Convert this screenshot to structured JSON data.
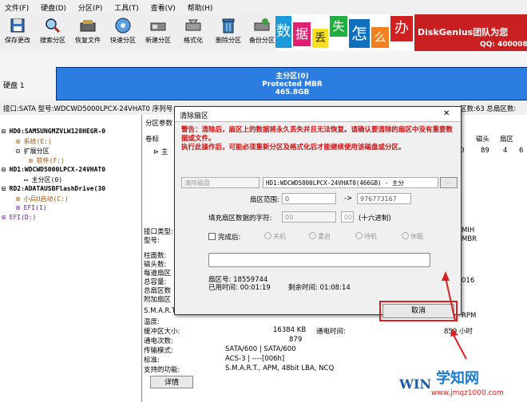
{
  "menu": [
    "文件(F)",
    "硬盘(D)",
    "分区(P)",
    "工具(T)",
    "查看(V)",
    "帮助(H)"
  ],
  "toolbar": {
    "buttons": [
      "保存更改",
      "搜索分区",
      "恢复文件",
      "快速分区",
      "新建分区",
      "格式化",
      "删除分区",
      "备份分区"
    ]
  },
  "banner": {
    "chars": [
      "数",
      "据",
      "丢",
      "失",
      "怎",
      "么",
      "办"
    ],
    "brand": "DiskGenius团队为您",
    "qq": "QQ: 400008"
  },
  "disk": {
    "label": "硬盘 1",
    "partition_title": "主分区(0)",
    "partition_type": "Protected MBR",
    "partition_size": "465.8GB"
  },
  "infoline": {
    "left": "接口:SATA  型号:WDCWD5000LPCX-24VHAT0  序列号",
    "right": "区数:63  总扇区数:"
  },
  "tree": [
    "HD0:SAMSUNGMZVLW128HEGR-0",
    "系统(E:)",
    "扩展分区",
    "软件(F:)",
    "HD1:WDCWD5000LPCX-24VHAT0",
    "主分区(0)",
    "RD2:ADATAUSBFlashDrive(30",
    "小兵U启动(C:)",
    "EFI(1)",
    "EFI(D:)"
  ],
  "right_panel": {
    "tab": "分区参数",
    "col_label": "卷标",
    "row1": "主",
    "headers": [
      "柱面",
      "磁头",
      "扇区"
    ],
    "row_values": [
      "0",
      "89",
      "4",
      "6"
    ],
    "params": [
      "接口类型:",
      "型号:",
      "柱面数:",
      "磁头数:",
      "每道扇区",
      "总容量:",
      "总扇区数",
      "附加扇区"
    ],
    "side_values": [
      "MIH",
      "MBR",
      "016",
      "RPM"
    ],
    "smart": [
      {
        "k": "S.M.A.R.T.",
        "v": ""
      },
      {
        "k": "温度:",
        "v": ""
      },
      {
        "k": "缓冲区大小:",
        "v": "16384 KB"
      },
      {
        "k": "通电次数:",
        "v": "879"
      },
      {
        "k": "传输模式:",
        "v": "SATA/600 | SATA/600"
      },
      {
        "k": "标准:",
        "v": "ACS-3 | ----[006h]"
      },
      {
        "k": "支持的功能:",
        "v": "S.M.A.R.T., APM, 48bit LBA, NCQ"
      }
    ],
    "power_time_label": "通电时间:",
    "power_time_value": "859 小时",
    "detail_button": "详情"
  },
  "dialog": {
    "title": "清除扇区",
    "warning1": "警告：清除后，扇区上的数据将永久丢失并且无法恢复。请确认要清除的扇区中没有重要数据或文件。",
    "warning2": "执行此操作后，可能必须重新分区及格式化后才能继续使用该磁盘或分区。",
    "target_select": "清除磁盘",
    "target_value": "HD1:WDCWD5000LPCX-24VHAT0(466GB) - 主分",
    "range_label": "扇区范围:",
    "range_from": "0",
    "range_arrow": "->",
    "range_to": "976773167",
    "fill_label": "填充扇区数据的字符:",
    "fill_select": "00",
    "fill_value": "00",
    "fill_hint": "(十六进制)",
    "after_label": "完成后:",
    "after_options": [
      "关机",
      "重启",
      "待机",
      "休眠"
    ],
    "sector_label": "扇区号:",
    "sector_value": "18559744",
    "elapsed_label": "已用时间:",
    "elapsed_value": "00:01:19",
    "remaining_label": "剩余时间:",
    "remaining_value": "01:08:14",
    "cancel_button": "取消"
  },
  "watermark": {
    "site": "学知网",
    "url": "www.jmqz1000.com",
    "logo": "WIN"
  }
}
